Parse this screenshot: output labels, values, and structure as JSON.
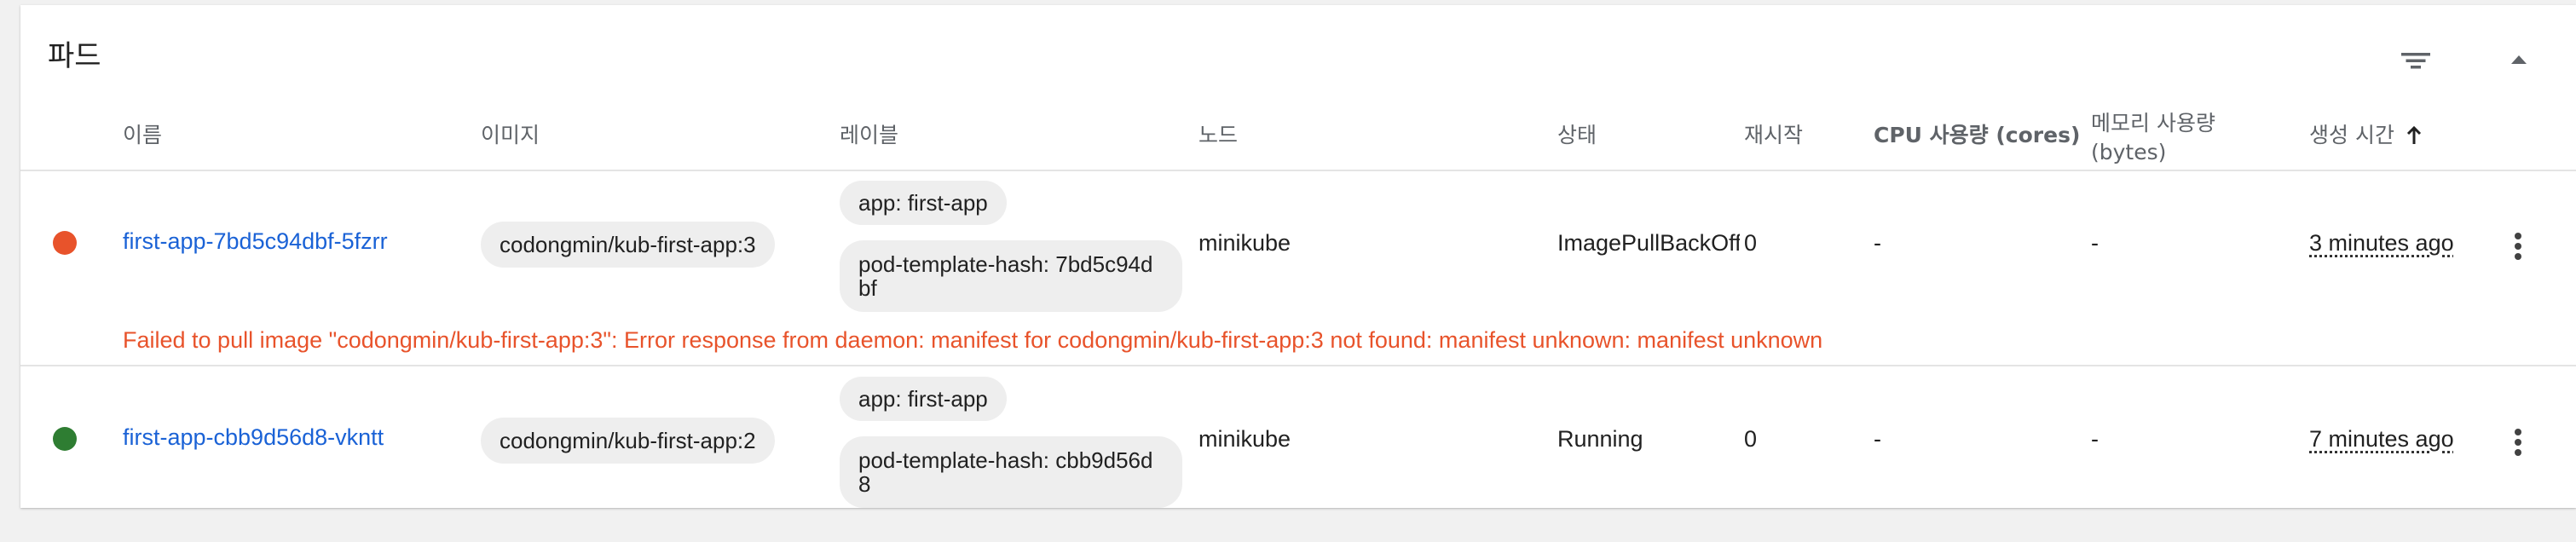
{
  "panel": {
    "title": "파드"
  },
  "colors": {
    "link": "#1a62d6",
    "error": "#e8532b",
    "success": "#2e7d32"
  },
  "columns": {
    "name": "이름",
    "image": "이미지",
    "labels": "레이블",
    "node": "노드",
    "status": "상태",
    "restarts": "재시작",
    "cpu": "CPU 사용량 (cores)",
    "memory_line1": "메모리 사용량",
    "memory_line2": "(bytes)",
    "created": "생성 시간"
  },
  "icons": {
    "filter": "filter-icon",
    "collapse": "chevron-up-icon",
    "sort": "arrow-up-icon",
    "menu": "more-vert-icon"
  },
  "pods": [
    {
      "status_color": "#e8532b",
      "name": "first-app-7bd5c94dbf-5fzrr",
      "image": "codongmin/kub-first-app:3",
      "labels": [
        "app: first-app",
        "pod-template-hash: 7bd5c94dbf"
      ],
      "node": "minikube",
      "status": "ImagePullBackOff",
      "restarts": "0",
      "cpu": "-",
      "memory": "-",
      "created": "3 minutes ago",
      "error": "Failed to pull image \"codongmin/kub-first-app:3\": Error response from daemon: manifest for codongmin/kub-first-app:3 not found: manifest unknown: manifest unknown"
    },
    {
      "status_color": "#2e7d32",
      "name": "first-app-cbb9d56d8-vkntt",
      "image": "codongmin/kub-first-app:2",
      "labels": [
        "app: first-app",
        "pod-template-hash: cbb9d56d8"
      ],
      "node": "minikube",
      "status": "Running",
      "restarts": "0",
      "cpu": "-",
      "memory": "-",
      "created": "7 minutes ago"
    }
  ]
}
